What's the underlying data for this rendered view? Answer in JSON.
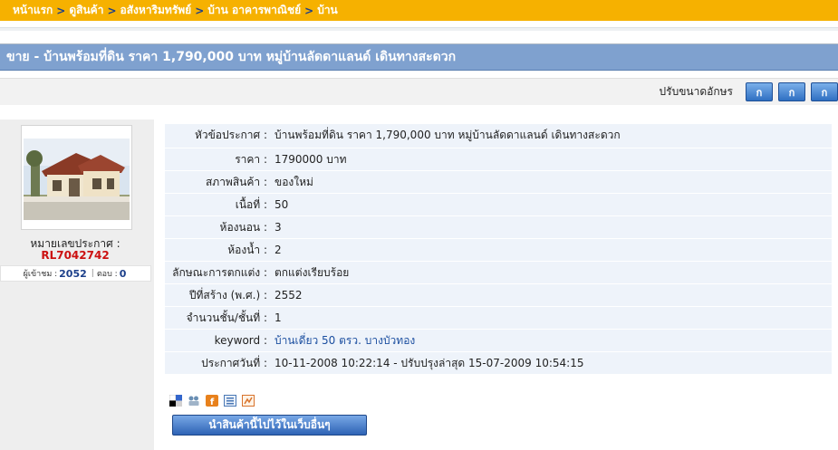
{
  "breadcrumb": {
    "items": [
      "หน้าแรก",
      "ดูสินค้า",
      "อสังหาริมทรัพย์",
      "บ้าน อาคารพาณิชย์",
      "บ้าน"
    ],
    "separator": ">"
  },
  "title": "ขาย - บ้านพร้อมที่ดิน ราคา 1,790,000 บาท หมู่บ้านลัดดาแลนด์ เดินทางสะดวก",
  "font_size": {
    "label": "ปรับขนาดอักษร",
    "buttons": [
      "ก",
      "ก",
      "ก"
    ]
  },
  "listing": {
    "ann_label": "หมายเลขประกาศ :",
    "ann_code": "RL7042742",
    "visitors_label": "ผู้เข้าชม :",
    "visitors": "2052",
    "replies_label": "ตอบ :",
    "replies": "0"
  },
  "details": [
    {
      "key": "หัวข้อประกาศ :",
      "value": "บ้านพร้อมที่ดิน ราคา 1,790,000 บาท หมู่บ้านลัดดาแลนด์ เดินทางสะดวก"
    },
    {
      "key": "ราคา :",
      "value": "1790000 บาท"
    },
    {
      "key": "สภาพสินค้า :",
      "value": "ของใหม่"
    },
    {
      "key": "เนื้อที่ :",
      "value": "50"
    },
    {
      "key": "ห้องนอน :",
      "value": "3"
    },
    {
      "key": "ห้องน้ำ :",
      "value": "2"
    },
    {
      "key": "ลักษณะการตกแต่ง :",
      "value": "ตกแต่งเรียบร้อย"
    },
    {
      "key": "ปีที่สร้าง (พ.ศ.) :",
      "value": "2552"
    },
    {
      "key": "จำนวนชั้น/ชั้นที่ :",
      "value": "1"
    },
    {
      "key": "keyword :",
      "value": "บ้านเดี่ยว 50 ตรว. บางบัวทอง"
    },
    {
      "key": "ประกาศวันที่ :",
      "value": "10-11-2008 10:22:14  - ปรับปรุงล่าสุด 15-07-2009 10:54:15"
    }
  ],
  "share_button": "นำสินค้านี้ไปไว้ในเว็บอื่นๆ",
  "colors": {
    "breadcrumb_bg": "#f6b100",
    "title_bg": "#7fa1cf",
    "row_bg": "#eef3fa",
    "code_red": "#cc1111"
  }
}
